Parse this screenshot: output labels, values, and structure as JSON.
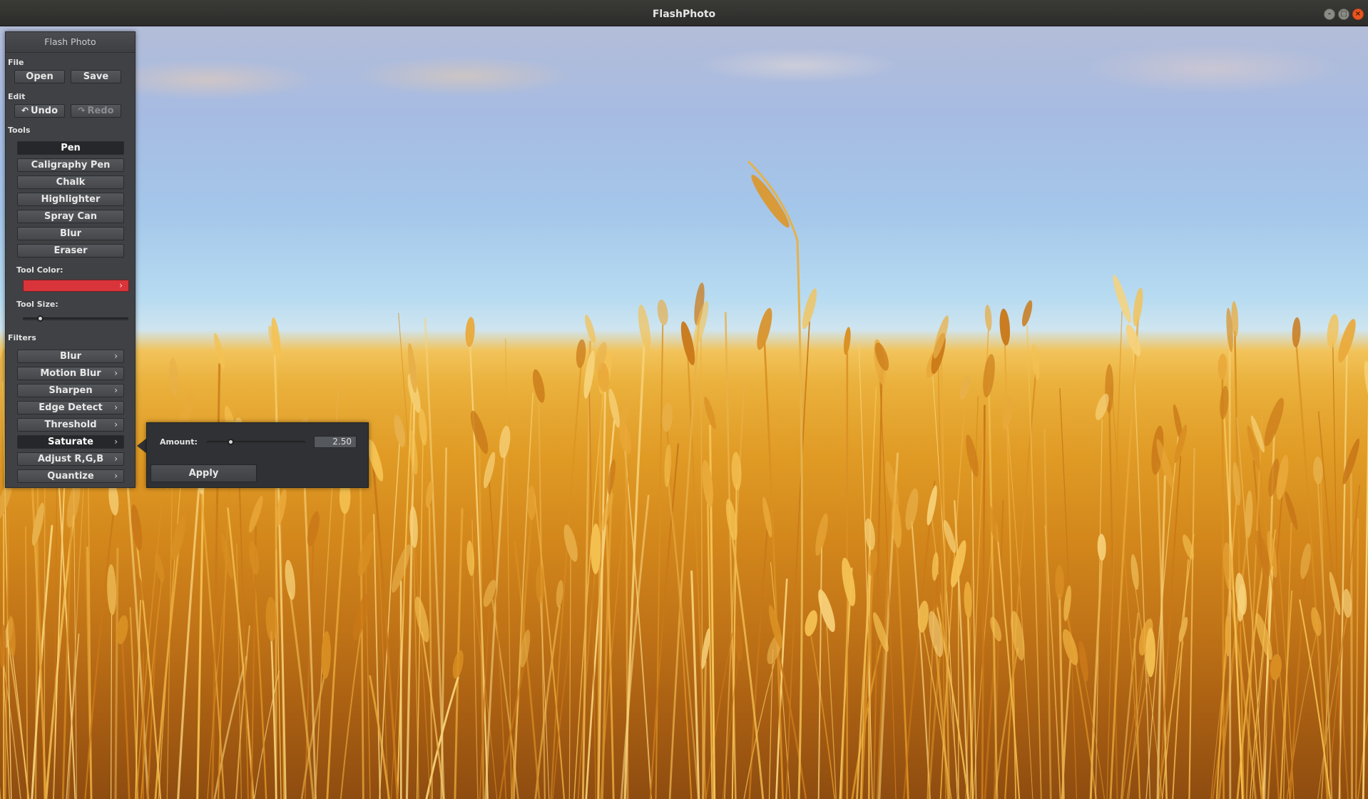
{
  "window": {
    "title": "FlashPhoto"
  },
  "panel": {
    "title": "Flash Photo",
    "file": {
      "label": "File",
      "open": "Open",
      "save": "Save"
    },
    "edit": {
      "label": "Edit",
      "undo": "Undo",
      "redo": "Redo",
      "undo_icon": "↶",
      "redo_icon": "↷"
    },
    "tools": {
      "label": "Tools",
      "items": [
        "Pen",
        "Caligraphy Pen",
        "Chalk",
        "Highlighter",
        "Spray Can",
        "Blur",
        "Eraser"
      ],
      "active": "Pen",
      "color_label": "Tool Color:",
      "color": "#d9343a",
      "size_label": "Tool Size:"
    },
    "filters": {
      "label": "Filters",
      "items": [
        "Blur",
        "Motion Blur",
        "Sharpen",
        "Edge Detect",
        "Threshold",
        "Saturate",
        "Adjust R,G,B",
        "Quantize"
      ],
      "active": "Saturate"
    }
  },
  "saturate_popup": {
    "amount_label": "Amount:",
    "amount_value": "2.50",
    "apply_label": "Apply"
  },
  "icons": {
    "submenu": "chevron-right-icon",
    "minimize": "minimize-icon",
    "maximize": "maximize-icon",
    "close": "close-icon"
  }
}
